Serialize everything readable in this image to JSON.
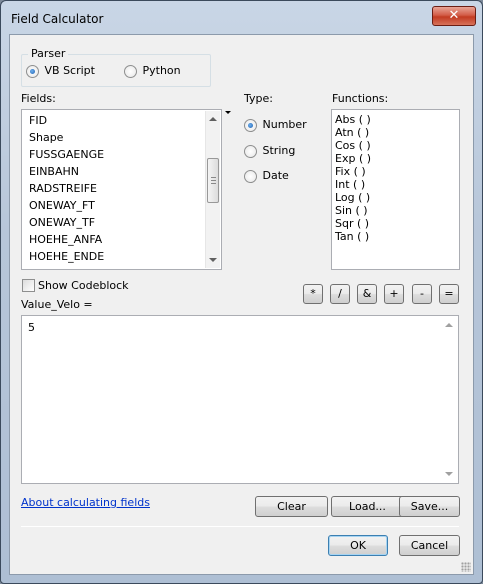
{
  "window": {
    "title": "Field Calculator",
    "close_glyph": "✕"
  },
  "parser": {
    "group_label": "Parser",
    "options": [
      {
        "label": "VB Script",
        "checked": true
      },
      {
        "label": "Python",
        "checked": false
      }
    ]
  },
  "fields": {
    "label": "Fields:",
    "items": [
      "FID",
      "Shape",
      "FUSSGAENGE",
      "EINBAHN",
      "RADSTREIFE",
      "ONEWAY_FT",
      "ONEWAY_TF",
      "HOEHE_ANFA",
      "HOEHE_ENDE"
    ]
  },
  "type": {
    "label": "Type:",
    "options": [
      {
        "label": "Number",
        "checked": true
      },
      {
        "label": "String",
        "checked": false
      },
      {
        "label": "Date",
        "checked": false
      }
    ]
  },
  "functions": {
    "label": "Functions:",
    "items": [
      "Abs ( )",
      "Atn ( )",
      "Cos ( )",
      "Exp ( )",
      "Fix ( )",
      "Int ( )",
      "Log ( )",
      "Sin ( )",
      "Sqr ( )",
      "Tan ( )"
    ]
  },
  "codeblock": {
    "label": "Show Codeblock",
    "checked": false
  },
  "operators": [
    "*",
    "/",
    "&",
    "+",
    "-",
    "="
  ],
  "expression": {
    "label": "Value_Velo =",
    "value": "5"
  },
  "help_link": "About calculating fields",
  "buttons": {
    "clear": "Clear",
    "load": "Load...",
    "save": "Save...",
    "ok": "OK",
    "cancel": "Cancel"
  },
  "icons": {
    "sort_arrow": "sort-down-icon"
  }
}
